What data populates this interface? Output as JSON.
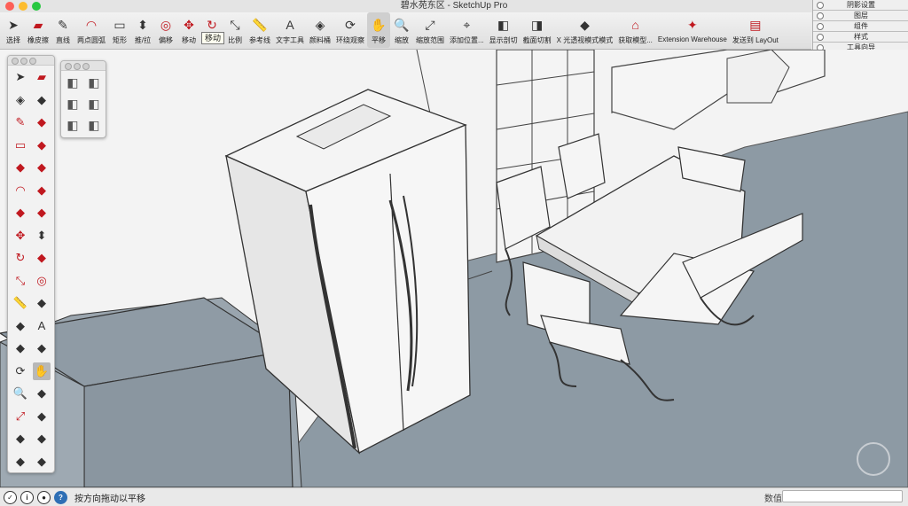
{
  "window": {
    "title": "碧水苑东区 - SketchUp Pro"
  },
  "toolbar": {
    "items": [
      {
        "id": "select",
        "label": "选择",
        "icon": "select-arrow-icon"
      },
      {
        "id": "eraser",
        "label": "橡皮擦",
        "icon": "eraser-icon"
      },
      {
        "id": "line",
        "label": "直线",
        "icon": "pencil-icon"
      },
      {
        "id": "arc",
        "label": "两点圆弧",
        "icon": "arc-icon"
      },
      {
        "id": "rect",
        "label": "矩形",
        "icon": "rectangle-icon"
      },
      {
        "id": "pushpull",
        "label": "推/拉",
        "icon": "push-pull-icon"
      },
      {
        "id": "offset",
        "label": "偏移",
        "icon": "offset-icon"
      },
      {
        "id": "move",
        "label": "移动",
        "icon": "move-icon"
      },
      {
        "id": "rotate",
        "label": "旋转",
        "icon": "rotate-icon"
      },
      {
        "id": "scale",
        "label": "比例",
        "icon": "scale-icon"
      },
      {
        "id": "tape",
        "label": "参考线",
        "icon": "tape-measure-icon"
      },
      {
        "id": "text",
        "label": "文字工具",
        "icon": "text-icon"
      },
      {
        "id": "paint",
        "label": "颜料桶",
        "icon": "paint-bucket-icon"
      },
      {
        "id": "orbit",
        "label": "环绕观察",
        "icon": "orbit-icon"
      },
      {
        "id": "pan",
        "label": "平移",
        "icon": "pan-hand-icon"
      },
      {
        "id": "zoom",
        "label": "缩放",
        "icon": "zoom-icon"
      },
      {
        "id": "extents",
        "label": "缩放范围",
        "icon": "zoom-extents-icon"
      },
      {
        "id": "position",
        "label": "添加位置...",
        "icon": "add-location-icon"
      },
      {
        "id": "showcut",
        "label": "显示剖切",
        "icon": "display-section-icon"
      },
      {
        "id": "sectioncut",
        "label": "截面切割",
        "icon": "section-cut-icon"
      },
      {
        "id": "xray",
        "label": "X 光透视模式模式",
        "icon": "xray-icon"
      },
      {
        "id": "getmodels",
        "label": "获取模型...",
        "icon": "warehouse-icon"
      },
      {
        "id": "extwh",
        "label": "Extension Warehouse",
        "icon": "extension-warehouse-icon"
      },
      {
        "id": "layout",
        "label": "发送到 LayOut",
        "icon": "layout-icon"
      }
    ],
    "tooltip": "移动"
  },
  "trays": [
    "阴影设置",
    "图层",
    "组件",
    "样式",
    "工具向导"
  ],
  "status": {
    "hint": "按方向拖动以平移",
    "measurements_label": "数值",
    "measurements_value": ""
  },
  "colors": {
    "floor": "#8e9aa4",
    "wall": "#f2f2f2",
    "accent": "#c0181f"
  }
}
